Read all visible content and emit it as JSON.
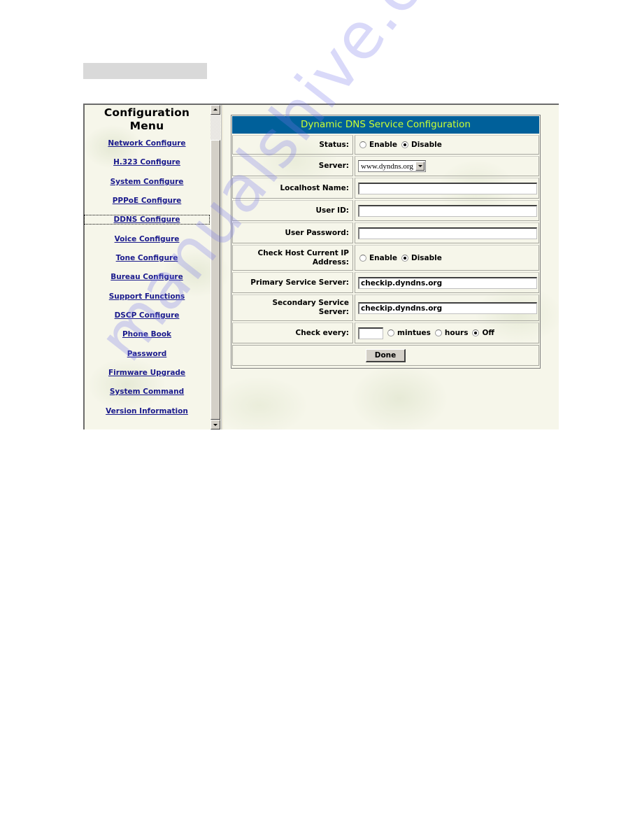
{
  "document": {
    "caption_placeholder": "",
    "watermark": "manualshive.com"
  },
  "sidebar": {
    "title_line1": "Configuration",
    "title_line2": "Menu",
    "items": [
      {
        "label": "Network Configure"
      },
      {
        "label": "H.323 Configure"
      },
      {
        "label": "System Configure"
      },
      {
        "label": "PPPoE Configure"
      },
      {
        "label": "DDNS Configure",
        "active": true
      },
      {
        "label": "Voice Configure"
      },
      {
        "label": "Tone Configure"
      },
      {
        "label": "Bureau Configure"
      },
      {
        "label": "Support Functions"
      },
      {
        "label": "DSCP Configure"
      },
      {
        "label": "Phone Book"
      },
      {
        "label": "Password"
      },
      {
        "label": "Firmware Upgrade"
      },
      {
        "label": "System Command"
      },
      {
        "label": "Version Information"
      }
    ]
  },
  "form": {
    "title": "Dynamic DNS Service Configuration",
    "status": {
      "label": "Status:",
      "options": [
        "Enable",
        "Disable"
      ],
      "selected": "Disable"
    },
    "server": {
      "label": "Server:",
      "value": "www.dyndns.org"
    },
    "localhost_name": {
      "label": "Localhost Name:",
      "value": ""
    },
    "user_id": {
      "label": "User ID:",
      "value": ""
    },
    "user_password": {
      "label": "User Password:",
      "value": ""
    },
    "check_host_ip": {
      "label": "Check Host Current IP Address:",
      "options": [
        "Enable",
        "Disable"
      ],
      "selected": "Disable"
    },
    "primary_server": {
      "label": "Primary Service Server:",
      "value": "checkip.dyndns.org"
    },
    "secondary_server": {
      "label": "Secondary Service Server:",
      "value": "checkip.dyndns.org"
    },
    "check_every": {
      "label": "Check every:",
      "value": "",
      "options": [
        "mintues",
        "hours",
        "Off"
      ],
      "selected": "Off"
    },
    "done_label": "Done"
  },
  "colors": {
    "header_bg": "#00609a",
    "header_text": "#ccff33",
    "link": "#1a1a8c"
  }
}
